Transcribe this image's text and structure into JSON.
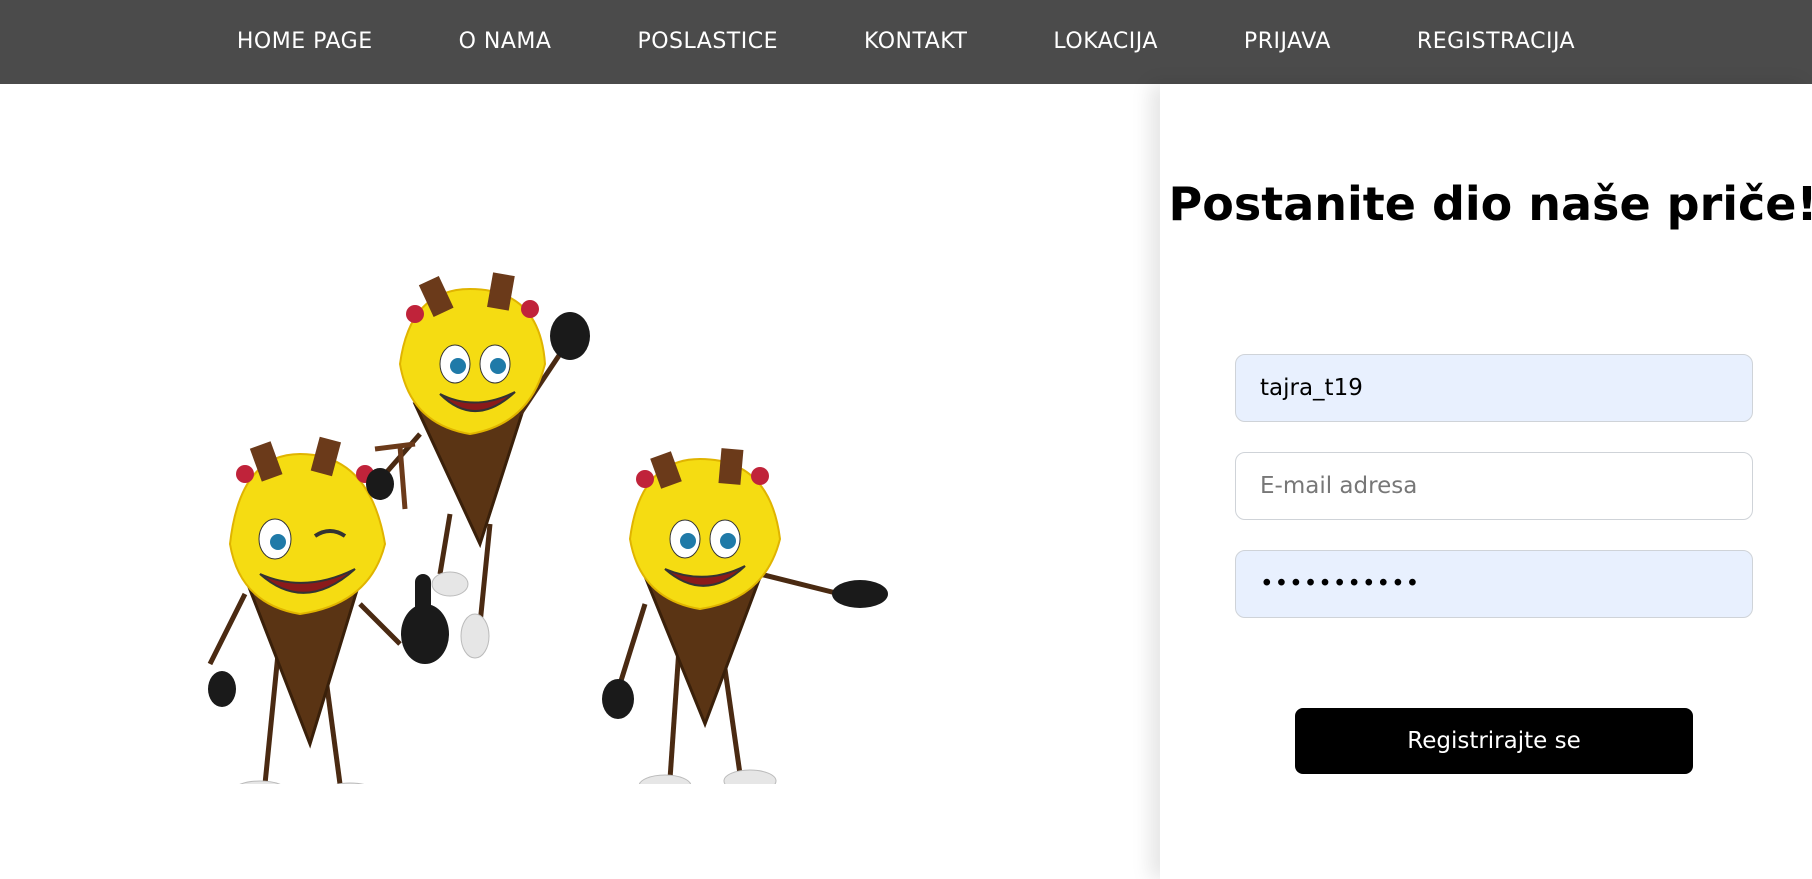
{
  "nav": {
    "items": [
      {
        "label": "HOME PAGE"
      },
      {
        "label": "O NAMA"
      },
      {
        "label": "POSLASTICE"
      },
      {
        "label": "KONTAKT"
      },
      {
        "label": "LOKACIJA"
      },
      {
        "label": "PRIJAVA"
      },
      {
        "label": "REGISTRACIJA"
      }
    ]
  },
  "form": {
    "title": "Postanite dio naše priče!",
    "username_value": "tajra_t19",
    "email_placeholder": "E-mail adresa",
    "password_value": "•••••••••••",
    "submit_label": "Registrirajte se"
  },
  "colors": {
    "nav_bg": "#4b4b4b",
    "autofill_bg": "#e8f0fe",
    "button_bg": "#000000"
  }
}
